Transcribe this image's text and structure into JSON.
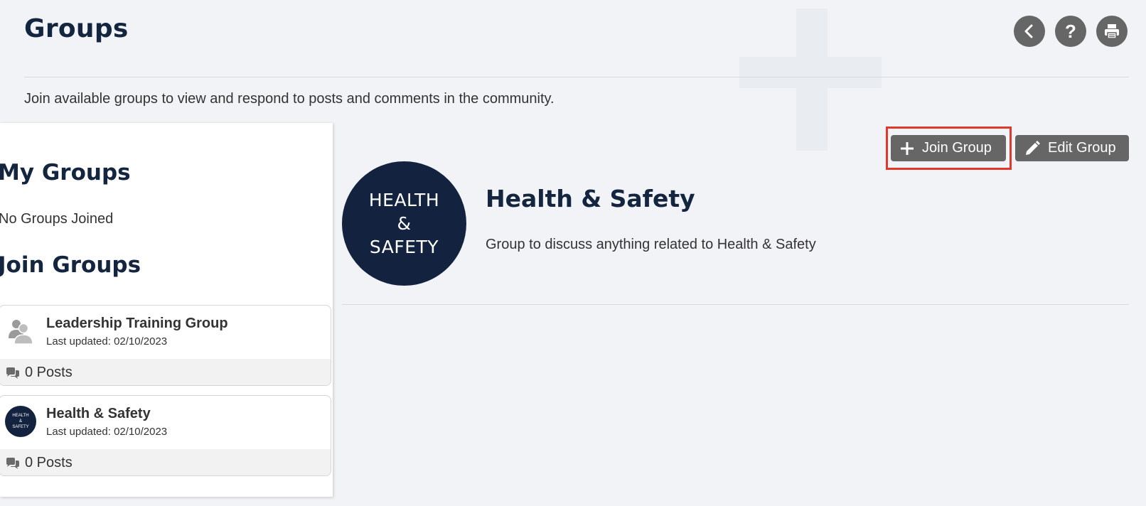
{
  "page": {
    "title": "Groups",
    "intro": "Join available groups to view and respond to posts and comments in the community."
  },
  "top_actions": [
    {
      "icon": "back-icon",
      "glyph": "‹"
    },
    {
      "icon": "help-icon",
      "glyph": "?"
    },
    {
      "icon": "print-icon",
      "glyph": ""
    }
  ],
  "sidebar": {
    "my_groups_heading": "My Groups",
    "no_groups_text": "No Groups Joined",
    "join_groups_heading": "Join Groups",
    "groups": [
      {
        "name": "Leadership Training Group",
        "updated": "Last updated: 02/10/2023",
        "posts": "0 Posts",
        "avatar": "people-icon"
      },
      {
        "name": "Health & Safety",
        "updated": "Last updated: 02/10/2023",
        "posts": "0 Posts",
        "avatar": "health-safety-logo",
        "avatar_lines": [
          "HEALTH",
          "&",
          "SAFETY"
        ]
      }
    ]
  },
  "detail": {
    "logo_lines": [
      "HEALTH",
      "&",
      "SAFETY"
    ],
    "title": "Health & Safety",
    "description": "Group to discuss anything related to Health & Safety",
    "join_label": "Join Group",
    "edit_label": "Edit Group"
  },
  "colors": {
    "heading": "#13253f",
    "button": "#666666",
    "logo_bg": "#13233f",
    "highlight": "#e0382b",
    "background": "#f1f3f6"
  }
}
